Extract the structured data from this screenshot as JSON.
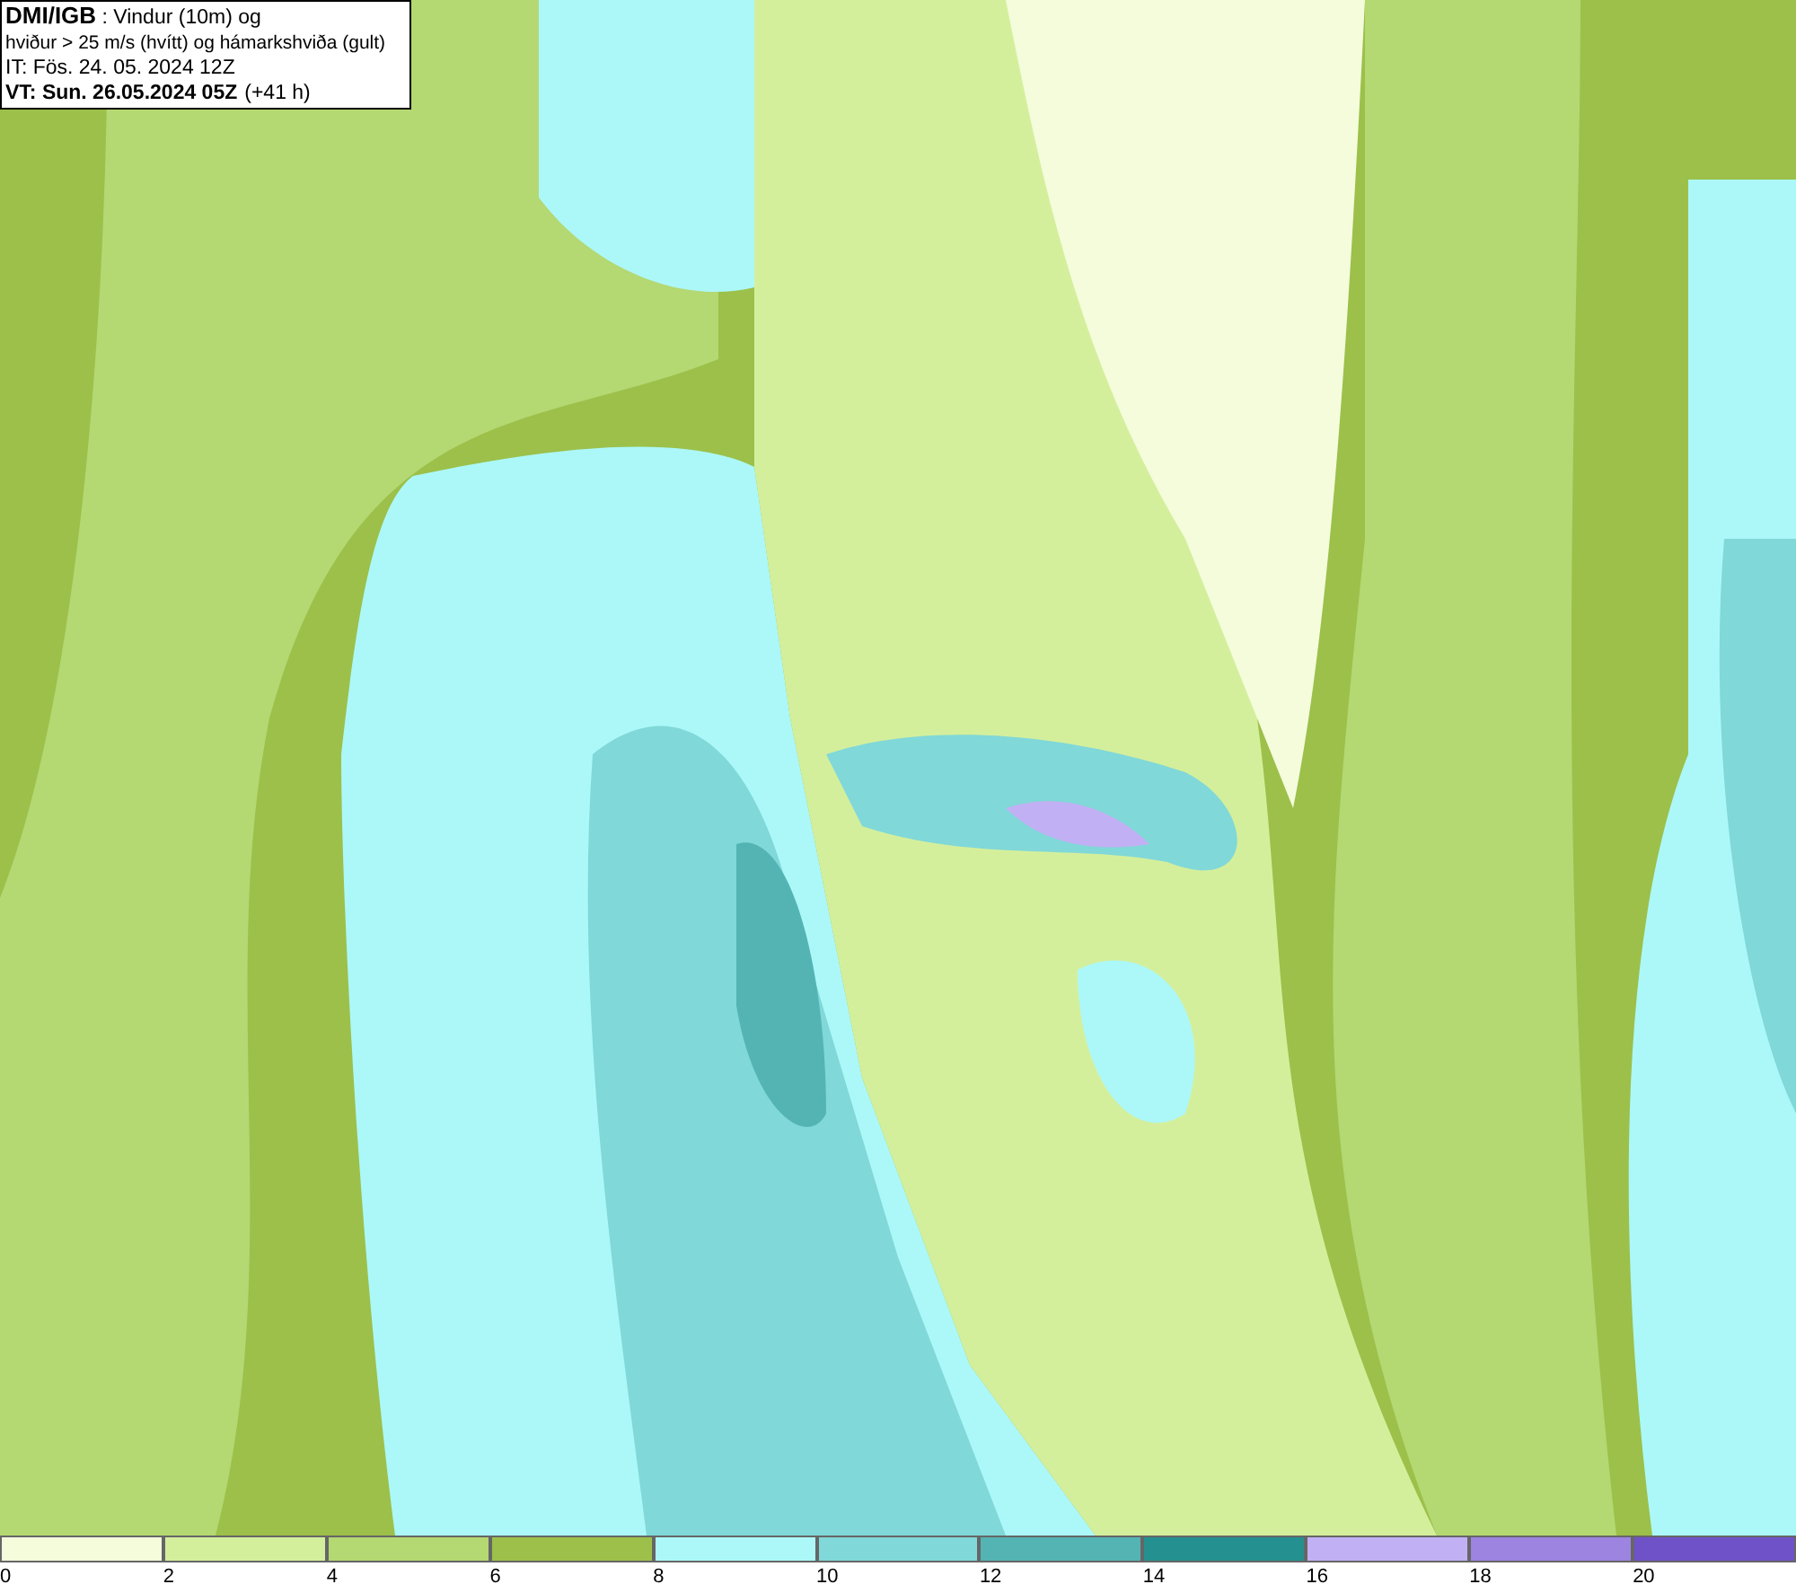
{
  "info_box": {
    "source": "DMI/IGB",
    "title": " : Vindur (10m) og",
    "line_2": "hviður > 25 m/s (hvítt) og hámarkshviða (gult)",
    "initial_time": "IT: Fös. 24. 05. 2024 12Z",
    "valid_time": "VT: Sun. 26.05.2024 05Z",
    "lead_time": "(+41 h)"
  },
  "legend": {
    "bins": [
      {
        "label": "0",
        "color": "#f4fcdc"
      },
      {
        "label": "2",
        "color": "#d4ef9c"
      },
      {
        "label": "4",
        "color": "#b4d872"
      },
      {
        "label": "6",
        "color": "#9cc04a"
      },
      {
        "label": "8",
        "color": "#acf8f8"
      },
      {
        "label": "10",
        "color": "#80d8d8"
      },
      {
        "label": "12",
        "color": "#54b4b4"
      },
      {
        "label": "14",
        "color": "#259090"
      },
      {
        "label": "16",
        "color": "#c2b0f4"
      },
      {
        "label": "18",
        "color": "#9c84e0"
      },
      {
        "label": "20",
        "color": "#7052c8"
      }
    ]
  }
}
